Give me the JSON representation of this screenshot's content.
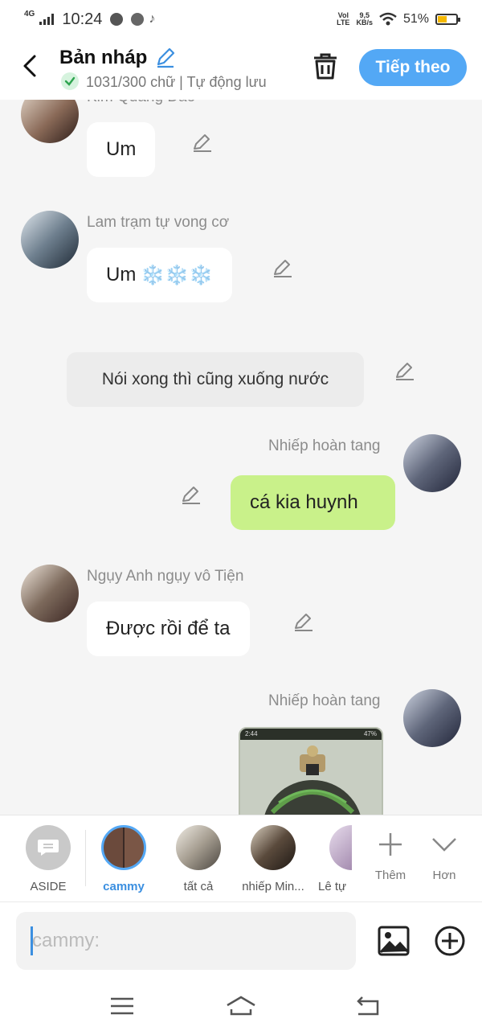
{
  "status": {
    "network": "4G",
    "time": "10:24",
    "volte_top": "Vol",
    "volte_bottom": "LTE",
    "speed_value": "9,5",
    "speed_unit": "KB/s",
    "battery": "51%",
    "battery_level": 0.51
  },
  "header": {
    "title": "Bản nháp",
    "subtitle": "1031/300 chữ | Tự động lưu",
    "next_label": "Tiếp theo"
  },
  "chat": {
    "messages": [
      {
        "name": "Kim Quang Dao",
        "text": "Um"
      },
      {
        "name": "Lam trạm tự vong cơ",
        "text": "Um",
        "emoji": "❄️❄️❄️"
      },
      {
        "aside": "Nói xong thì cũng xuống nước"
      },
      {
        "name": "Nhiếp hoàn tang",
        "text": "cá kia huynh"
      },
      {
        "name": "Ngụy Anh ngụy vô Tiện",
        "text": "Được rồi để ta"
      },
      {
        "name": "Nhiếp hoàn tang",
        "shot_time": "2:44",
        "shot_battery": "47%"
      }
    ]
  },
  "characters": [
    {
      "label": "ASIDE"
    },
    {
      "label": "cammy"
    },
    {
      "label": "tất cả"
    },
    {
      "label": "nhiếp Min..."
    },
    {
      "label": "Lê tự"
    }
  ],
  "tools": {
    "add_label": "Thêm",
    "more_label": "Hơn"
  },
  "input": {
    "placeholder": "cammy:"
  },
  "colors": {
    "accent": "#53a8f5",
    "bubble_green": "#c9f18a",
    "aside_bg": "#ececec"
  }
}
